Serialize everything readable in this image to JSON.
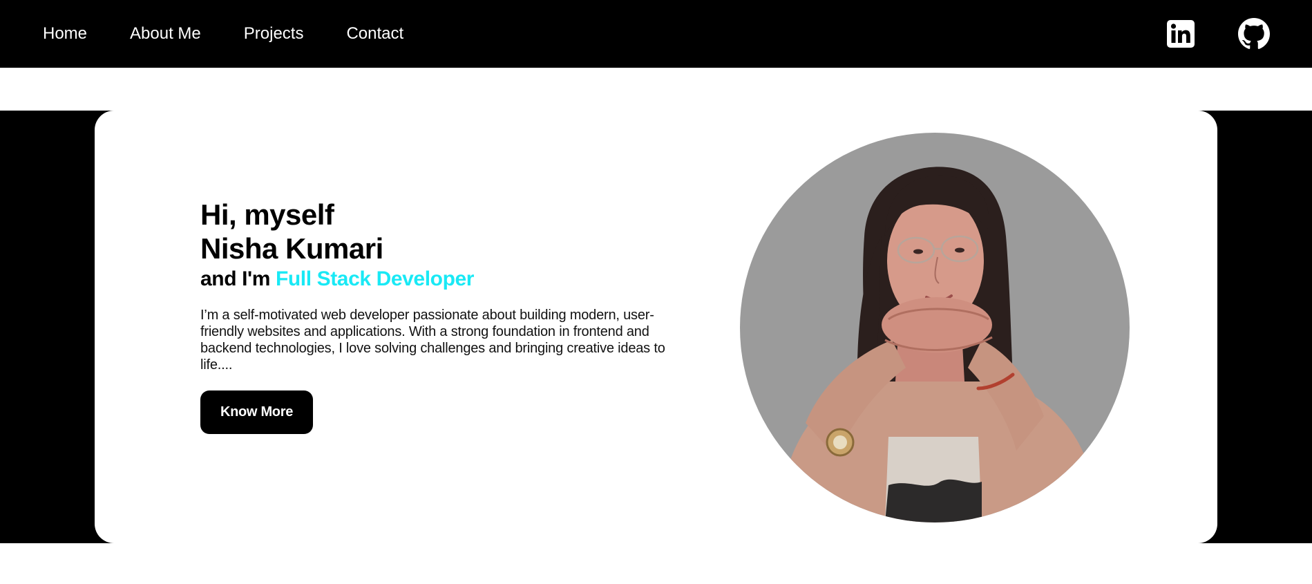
{
  "nav": {
    "links": [
      "Home",
      "About Me",
      "Projects",
      "Contact"
    ],
    "icons": [
      "linkedin-icon",
      "github-icon"
    ]
  },
  "hero": {
    "greeting": "Hi, myself",
    "name": "Nisha Kumari",
    "role_prefix": "and I'm",
    "role": "Full Stack Developer",
    "bio": "I’m a self-motivated web developer passionate about building modern, user-friendly websites and applications. With a strong foundation in frontend and backend technologies, I love solving challenges and bringing creative ideas to life....",
    "button_label": "Know More"
  },
  "colors": {
    "background": "#ffffff",
    "dark": "#000000",
    "accent": "#19e9f5",
    "portrait_bg": "#9b9b9b"
  }
}
